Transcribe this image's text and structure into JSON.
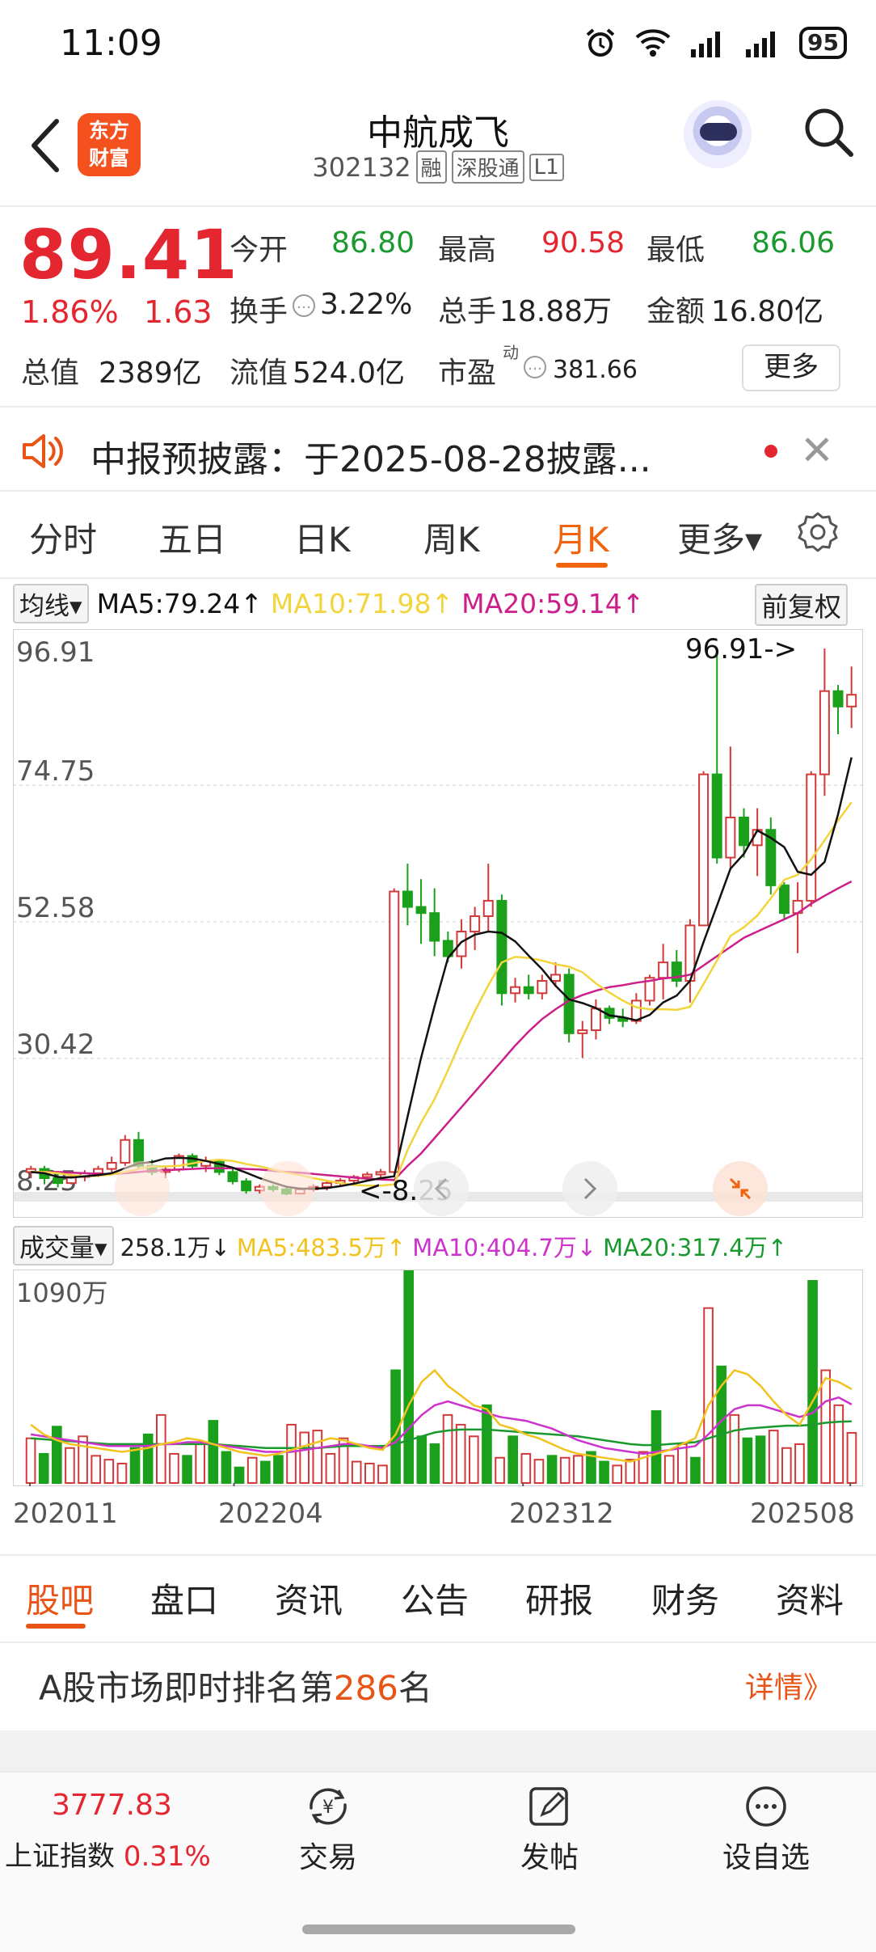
{
  "status_bar": {
    "time": "11:09",
    "battery": "95",
    "icons": [
      "alarm-icon",
      "wifi-icon",
      "signal-icon",
      "signal-icon",
      "battery-icon"
    ]
  },
  "header": {
    "logo_line1": "东方",
    "logo_line2": "财富",
    "title": "中航成飞",
    "code": "302132",
    "tags": [
      "融",
      "深股通",
      "L1"
    ],
    "icons": [
      "back-icon",
      "robot-assistant-icon",
      "search-icon"
    ]
  },
  "quote": {
    "price": "89.41",
    "change_pct": "1.86%",
    "change_amt": "1.63",
    "open_label": "今开",
    "open": "86.80",
    "high_label": "最高",
    "high": "90.58",
    "low_label": "最低",
    "low": "86.06",
    "turnover_label": "换手",
    "turnover": "3.22%",
    "volume_label": "总手",
    "volume": "18.88万",
    "amount_label": "金额",
    "amount": "16.80亿",
    "mktcap_label": "总值",
    "mktcap": "2389亿",
    "float_label": "流值",
    "float": "524.0亿",
    "pe_label": "市盈",
    "pe_sup": "动",
    "pe": "381.66",
    "more": "更多"
  },
  "notice": {
    "text": "中报预披露：于2025-08-28披露...",
    "icon": "speaker-icon"
  },
  "period_tabs": [
    "分时",
    "五日",
    "日K",
    "周K",
    "月K",
    "更多▾"
  ],
  "active_period": "月K",
  "chart_ma": {
    "label": "均线",
    "ma5": "MA5:79.24↑",
    "ma10": "MA10:71.98↑",
    "ma20": "MA20:59.14↑",
    "adjust": "前复权",
    "colors": {
      "ma5": "#111111",
      "ma10": "#f2d43c",
      "ma20": "#cc1f8a",
      "up": "#d23a3a",
      "down": "#1aa01a"
    }
  },
  "chart_data": {
    "type": "candlestick",
    "y_ticks": [
      "96.91",
      "74.75",
      "52.58",
      "30.42",
      "8.25"
    ],
    "ylim": [
      8.25,
      96.91
    ],
    "max_label": "96.91->",
    "min_label": "<-8.25",
    "x_ticks": [
      "202011",
      "202204",
      "202312",
      "202508"
    ],
    "candles": [
      [
        12.0,
        13.0,
        11.0,
        12.5
      ],
      [
        12.5,
        13.0,
        10.0,
        11.0
      ],
      [
        11.0,
        12.0,
        9.5,
        10.2
      ],
      [
        10.2,
        11.5,
        10.0,
        11.2
      ],
      [
        11.2,
        12.3,
        10.5,
        11.8
      ],
      [
        11.8,
        13.0,
        11.2,
        12.5
      ],
      [
        12.5,
        14.5,
        12.0,
        13.5
      ],
      [
        13.5,
        18.0,
        13.0,
        17.2
      ],
      [
        17.2,
        18.5,
        12.5,
        13.0
      ],
      [
        13.0,
        14.0,
        11.5,
        12.0
      ],
      [
        12.0,
        13.0,
        11.0,
        12.4
      ],
      [
        12.4,
        15.0,
        12.0,
        14.6
      ],
      [
        14.6,
        15.0,
        12.5,
        13.0
      ],
      [
        13.0,
        14.5,
        12.0,
        13.8
      ],
      [
        13.8,
        14.0,
        11.5,
        12.0
      ],
      [
        12.0,
        12.5,
        10.0,
        10.5
      ],
      [
        10.5,
        11.0,
        8.5,
        9.0
      ],
      [
        9.0,
        10.0,
        8.5,
        9.6
      ],
      [
        9.6,
        10.0,
        8.8,
        9.2
      ],
      [
        9.2,
        9.8,
        8.25,
        8.5
      ],
      [
        8.5,
        9.5,
        8.4,
        9.2
      ],
      [
        9.2,
        10.0,
        8.8,
        9.6
      ],
      [
        9.6,
        10.5,
        9.0,
        10.2
      ],
      [
        10.2,
        11.0,
        9.8,
        10.6
      ],
      [
        10.6,
        11.5,
        10.0,
        11.2
      ],
      [
        11.2,
        12.0,
        10.8,
        11.6
      ],
      [
        11.6,
        12.5,
        11.0,
        12.0
      ],
      [
        12.0,
        58.0,
        11.8,
        57.5
      ],
      [
        57.5,
        62.0,
        52.0,
        55.0
      ],
      [
        55.0,
        59.5,
        49.0,
        54.0
      ],
      [
        54.0,
        58.0,
        47.0,
        49.5
      ],
      [
        49.5,
        51.0,
        46.0,
        47.0
      ],
      [
        47.0,
        53.0,
        45.0,
        51.0
      ],
      [
        51.0,
        55.0,
        48.0,
        53.5
      ],
      [
        53.5,
        62.0,
        51.0,
        56.0
      ],
      [
        56.0,
        57.0,
        39.0,
        41.0
      ],
      [
        41.0,
        43.5,
        39.5,
        42.0
      ],
      [
        42.0,
        44.0,
        40.0,
        41.0
      ],
      [
        41.0,
        44.0,
        40.0,
        43.0
      ],
      [
        43.0,
        46.0,
        42.0,
        44.0
      ],
      [
        44.0,
        45.0,
        33.0,
        34.5
      ],
      [
        34.5,
        36.5,
        30.5,
        35.0
      ],
      [
        35.0,
        40.0,
        33.5,
        38.5
      ],
      [
        38.5,
        39.0,
        36.0,
        37.0
      ],
      [
        37.0,
        38.5,
        35.5,
        36.5
      ],
      [
        36.5,
        41.0,
        36.0,
        39.8
      ],
      [
        39.8,
        44.0,
        39.0,
        43.5
      ],
      [
        43.5,
        49.0,
        40.0,
        46.0
      ],
      [
        46.0,
        48.0,
        42.0,
        43.0
      ],
      [
        43.0,
        53.0,
        39.5,
        52.0
      ],
      [
        52.0,
        77.0,
        54.0,
        76.5
      ],
      [
        76.5,
        96.5,
        62.0,
        63.0
      ],
      [
        63.0,
        81.0,
        61.0,
        69.5
      ],
      [
        69.5,
        71.0,
        63.0,
        65.0
      ],
      [
        65.0,
        71.0,
        60.0,
        67.5
      ],
      [
        67.5,
        69.5,
        57.0,
        58.5
      ],
      [
        58.5,
        59.0,
        53.0,
        54.0
      ],
      [
        54.0,
        59.0,
        47.5,
        56.0
      ],
      [
        56.0,
        77.0,
        55.0,
        76.5
      ],
      [
        76.5,
        96.91,
        73.0,
        90.0
      ],
      [
        90.0,
        91.0,
        83.0,
        87.5
      ],
      [
        87.5,
        94.0,
        84.0,
        89.41
      ]
    ],
    "ma5": [
      12.0,
      11.8,
      11.2,
      11.1,
      11.3,
      11.5,
      11.8,
      12.6,
      13.4,
      13.6,
      14.2,
      14.3,
      14.2,
      13.8,
      13.3,
      12.7,
      11.9,
      11.0,
      10.3,
      9.6,
      9.3,
      9.3,
      9.4,
      9.7,
      10.1,
      10.6,
      11.0,
      11.3,
      21.0,
      30.5,
      38.9,
      46.7,
      49.3,
      50.5,
      51.0,
      50.8,
      49.4,
      47.1,
      44.9,
      42.2,
      40.0,
      39.4,
      38.6,
      37.4,
      37.1,
      36.6,
      37.5,
      39.5,
      40.6,
      43.0,
      49.3,
      55.2,
      61.2,
      63.6,
      67.4,
      66.2,
      64.7,
      60.7,
      60.2,
      62.3,
      70.0,
      79.24
    ],
    "ma10": [
      12.0,
      12.0,
      11.8,
      11.5,
      11.3,
      11.4,
      11.6,
      12.0,
      12.5,
      12.9,
      12.9,
      13.0,
      13.4,
      13.8,
      14.0,
      13.8,
      13.3,
      12.9,
      12.4,
      11.9,
      11.5,
      11.0,
      10.6,
      10.2,
      9.9,
      9.8,
      9.8,
      10.0,
      15.6,
      20.0,
      23.8,
      28.5,
      33.5,
      38.1,
      42.3,
      46.0,
      46.9,
      46.7,
      46.3,
      45.7,
      45.3,
      44.4,
      42.6,
      41.1,
      39.8,
      38.7,
      38.4,
      38.4,
      38.3,
      38.8,
      42.5,
      46.3,
      50.3,
      51.7,
      53.6,
      56.4,
      59.4,
      60.2,
      62.7,
      65.8,
      69.0,
      71.98
    ],
    "ma20": [
      12.0,
      12.0,
      12.0,
      11.9,
      11.8,
      11.7,
      11.7,
      11.8,
      12.0,
      12.2,
      12.3,
      12.4,
      12.5,
      12.6,
      12.6,
      12.6,
      12.5,
      12.4,
      12.2,
      12.0,
      11.9,
      11.7,
      11.5,
      11.3,
      11.1,
      10.9,
      10.8,
      10.7,
      13.0,
      15.0,
      17.5,
      20.0,
      22.5,
      25.0,
      27.5,
      30.0,
      32.5,
      34.8,
      36.8,
      38.4,
      39.8,
      40.7,
      41.4,
      42.0,
      42.3,
      42.7,
      43.0,
      43.4,
      43.6,
      44.0,
      45.5,
      47.0,
      48.5,
      50.0,
      51.0,
      52.0,
      53.0,
      54.0,
      55.5,
      56.8,
      58.0,
      59.14
    ]
  },
  "volume_header": {
    "label": "成交量",
    "value": "258.1万↓",
    "ma5": "MA5:483.5万↑",
    "ma10": "MA10:404.7万↓",
    "ma20": "MA20:317.4万↑",
    "max_label": "1090万",
    "colors": {
      "ma5": "#f2c21f",
      "ma10": "#cc33cc",
      "ma20": "#1a9a2e"
    }
  },
  "volume_data": {
    "max": 1090,
    "bars": [
      230,
      150,
      290,
      180,
      240,
      140,
      120,
      100,
      180,
      250,
      350,
      150,
      140,
      200,
      320,
      160,
      80,
      130,
      110,
      140,
      300,
      260,
      270,
      150,
      230,
      110,
      100,
      90,
      580,
      1090,
      240,
      200,
      350,
      300,
      240,
      400,
      130,
      240,
      150,
      120,
      140,
      130,
      140,
      160,
      110,
      90,
      120,
      160,
      370,
      140,
      200,
      130,
      900,
      600,
      350,
      230,
      240,
      270,
      180,
      200,
      1040,
      580,
      400,
      258
    ],
    "ma5": [
      300,
      250,
      220,
      200,
      190,
      180,
      170,
      160,
      170,
      180,
      200,
      210,
      230,
      220,
      200,
      180,
      160,
      150,
      140,
      150,
      170,
      190,
      210,
      230,
      220,
      200,
      180,
      170,
      250,
      400,
      520,
      580,
      500,
      450,
      400,
      380,
      300,
      280,
      250,
      230,
      200,
      170,
      150,
      140,
      130,
      120,
      110,
      130,
      150,
      170,
      200,
      230,
      400,
      500,
      580,
      560,
      500,
      420,
      350,
      300,
      420,
      540,
      520,
      483
    ],
    "ma10": [
      250,
      240,
      230,
      220,
      210,
      200,
      190,
      190,
      190,
      190,
      200,
      200,
      210,
      210,
      200,
      190,
      180,
      170,
      160,
      160,
      160,
      170,
      180,
      190,
      200,
      200,
      190,
      180,
      210,
      280,
      350,
      400,
      420,
      400,
      380,
      360,
      340,
      330,
      320,
      300,
      280,
      250,
      220,
      200,
      180,
      170,
      160,
      150,
      160,
      170,
      180,
      190,
      250,
      320,
      380,
      400,
      400,
      380,
      360,
      340,
      360,
      420,
      440,
      404
    ],
    "ma20": [
      230,
      225,
      220,
      215,
      210,
      205,
      200,
      200,
      200,
      200,
      200,
      200,
      200,
      200,
      200,
      195,
      190,
      185,
      180,
      180,
      180,
      180,
      180,
      185,
      190,
      190,
      190,
      190,
      200,
      220,
      240,
      260,
      270,
      275,
      275,
      275,
      270,
      265,
      260,
      255,
      250,
      245,
      240,
      230,
      220,
      210,
      200,
      195,
      195,
      200,
      205,
      210,
      230,
      250,
      270,
      280,
      285,
      290,
      295,
      295,
      300,
      310,
      315,
      317
    ]
  },
  "bottom_tabs": [
    "股吧",
    "盘口",
    "资讯",
    "公告",
    "研报",
    "财务",
    "资料"
  ],
  "ranking": {
    "prefix": "A股市场即时排名第",
    "rank": "286",
    "suffix": "名",
    "detail": "详情》"
  },
  "footer": {
    "index_value": "3777.83",
    "index_name": "上证指数",
    "index_change": "0.31%",
    "trade": "交易",
    "post": "发帖",
    "watch": "设自选"
  }
}
